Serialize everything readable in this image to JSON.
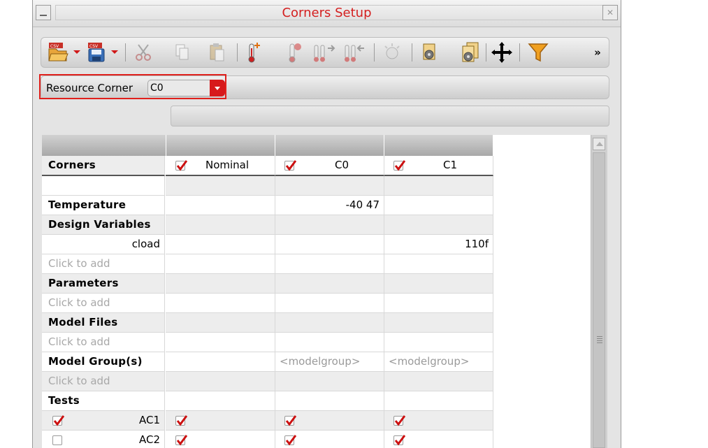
{
  "window": {
    "title": "Corners Setup"
  },
  "toolbar": {
    "buttons": [
      {
        "name": "open-csv-button",
        "icon": "folder-open-csv-icon",
        "enabled": true
      },
      {
        "name": "save-csv-button",
        "icon": "save-csv-icon",
        "enabled": true
      },
      {
        "name": "cut-button",
        "icon": "scissors-icon",
        "enabled": false
      },
      {
        "name": "copy-button",
        "icon": "copy-icon",
        "enabled": false
      },
      {
        "name": "paste-button",
        "icon": "paste-icon",
        "enabled": false
      },
      {
        "name": "add-temperature-button",
        "icon": "thermometer-add-icon",
        "enabled": true
      },
      {
        "name": "remove-temperature-button",
        "icon": "thermometer-remove-icon",
        "enabled": false
      },
      {
        "name": "import-button",
        "icon": "thermometer-import-icon",
        "enabled": false
      },
      {
        "name": "export-button",
        "icon": "thermometer-export-icon",
        "enabled": false
      },
      {
        "name": "light-button",
        "icon": "lightbulb-icon",
        "enabled": false
      },
      {
        "name": "settings-button",
        "icon": "gear-document-icon",
        "enabled": true
      },
      {
        "name": "settings-all-button",
        "icon": "gear-documents-icon",
        "enabled": true
      },
      {
        "name": "move-button",
        "icon": "move-cross-icon",
        "enabled": true
      },
      {
        "name": "filter-button",
        "icon": "funnel-icon",
        "enabled": true
      }
    ],
    "overflow_label": "»"
  },
  "resource_corner": {
    "label": "Resource Corner",
    "value": "C0"
  },
  "grid": {
    "row_header": "Corners",
    "columns": [
      {
        "label": "Nominal",
        "checked": true
      },
      {
        "label": "C0",
        "checked": true
      },
      {
        "label": "C1",
        "checked": true
      }
    ],
    "rows": {
      "temperature": {
        "label": "Temperature",
        "values": [
          "",
          "-40 47",
          ""
        ]
      },
      "design_variables": {
        "label": "Design Variables"
      },
      "cload": {
        "label": "cload",
        "values": [
          "",
          "",
          "110f"
        ]
      },
      "dv_add": {
        "label": "Click to add"
      },
      "parameters": {
        "label": "Parameters"
      },
      "param_add": {
        "label": "Click to add"
      },
      "model_files": {
        "label": "Model Files"
      },
      "mf_add": {
        "label": "Click to add"
      },
      "model_groups": {
        "label": "Model Group(s)",
        "values": [
          "",
          "<modelgroup>",
          "<modelgroup>"
        ]
      },
      "mg_add": {
        "label": "Click to add"
      },
      "tests": {
        "label": "Tests"
      },
      "ac1": {
        "label": "AC1",
        "enabled": true,
        "values": [
          true,
          true,
          true
        ]
      },
      "ac2": {
        "label": "AC2",
        "enabled": false,
        "values": [
          true,
          true,
          true
        ]
      }
    }
  },
  "colors": {
    "title": "#d42020",
    "accent": "#e0201c",
    "check": "#cc1111"
  }
}
